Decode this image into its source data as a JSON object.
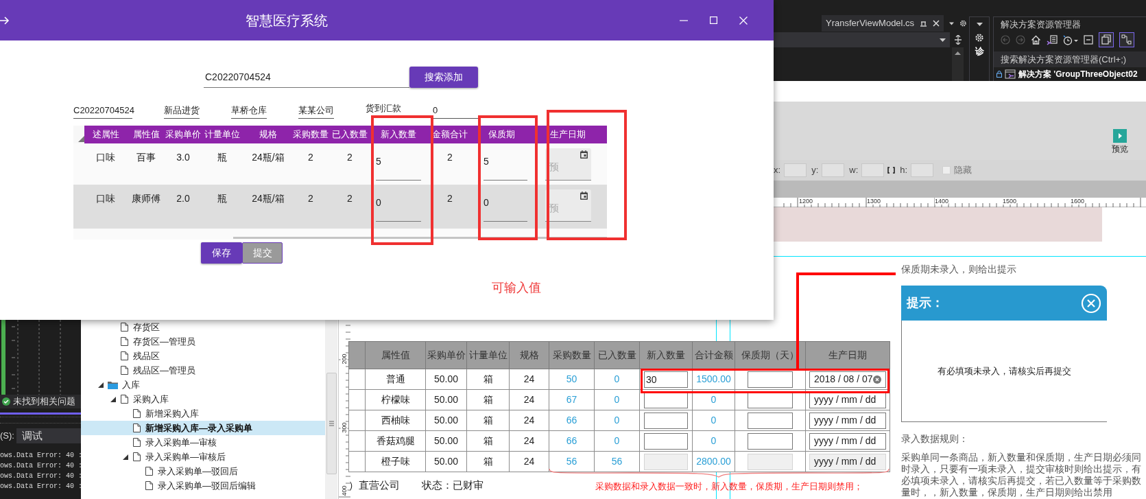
{
  "app_window": {
    "title": "智慧医疗系统",
    "search": {
      "value": "C20220704524"
    },
    "search_button": "搜索添加",
    "order_fields": [
      {
        "kind": "field",
        "value": "C20220704524"
      },
      {
        "kind": "field",
        "value": "新品进货"
      },
      {
        "kind": "field",
        "value": "草桥仓库"
      },
      {
        "kind": "field",
        "value": "某某公司"
      },
      {
        "kind": "label",
        "value": "货到汇款"
      },
      {
        "kind": "field",
        "value": "0"
      }
    ],
    "grid": {
      "columns": [
        "述属性",
        "属性值",
        "采购单价",
        "计量单位",
        "规格",
        "采购数量",
        "已入数量",
        "新入数量",
        "金额合计",
        "保质期",
        "生产日期"
      ],
      "rows": [
        {
          "cells": [
            "口味",
            "百事",
            "3.0",
            "瓶",
            "24瓶/箱",
            "2",
            "2"
          ],
          "new_quantity": "5",
          "amount": "2",
          "shelf_life": "5",
          "date_placeholder": "预"
        },
        {
          "cells": [
            "口味",
            "康师傅",
            "2.0",
            "瓶",
            "24瓶/箱",
            "2",
            "2"
          ],
          "new_quantity": "0",
          "amount": "2",
          "shelf_life": "0",
          "date_placeholder": "预"
        }
      ]
    },
    "buttons": [
      {
        "label": "保存",
        "disabled": false
      },
      {
        "label": "提交",
        "disabled": true
      }
    ],
    "annotation": "可输入值"
  },
  "ide": {
    "editor_tab": "YransferViewModel.cs",
    "diagnostics_label": "诊",
    "explorer_title": "解决方案资源管理器",
    "explorer_search": "搜索解决方案资源管理器(Ctrl+;)",
    "solution": "解决方案 'GroupThreeObject02",
    "preview": "预览",
    "position_labels": [
      "x:",
      "y:",
      "w:",
      "h:"
    ],
    "hide_label": "隐藏",
    "hide_checked": false,
    "ruler_labels": [
      "1200",
      "1300",
      "1400",
      "1500",
      "1600"
    ]
  },
  "error_list": {
    "status": "未找到相关问题",
    "output_label": "(S):",
    "output_source": "调试",
    "output_lines": [
      "ows.Data Error: 40 :",
      "ows.Data Error: 40 :",
      "ows.Data Error: 40 :",
      "ows.Data Error: 40 :"
    ]
  },
  "tree": {
    "upper_children": [
      {
        "label": "存货区",
        "selected": false
      },
      {
        "label": "存货区—管理员",
        "selected": false
      },
      {
        "label": "残品区",
        "selected": false
      },
      {
        "label": "残品区—管理员",
        "selected": false
      }
    ],
    "items": [
      {
        "label": "入库",
        "kind": "folder",
        "expanded": true,
        "selected": false,
        "children": [
          {
            "label": "采购入库",
            "expanded": true,
            "selected": false,
            "children": [
              {
                "label": "新增采购入库",
                "selected": false
              },
              {
                "label": "新增采购入库—录入采购单",
                "selected": true
              },
              {
                "label": "录入采购单—审核",
                "selected": false
              },
              {
                "label": "录入采购单—审核后",
                "expanded": true,
                "selected": false,
                "children": [
                  {
                    "label": "录入采购单—驳回后",
                    "selected": false
                  },
                  {
                    "label": "录入采购单—驳回后编辑",
                    "selected": false
                  }
                ]
              }
            ]
          }
        ]
      }
    ]
  },
  "vertical_ruler": [
    "200",
    "300",
    "400"
  ],
  "design_table": {
    "columns": [
      "属性值",
      "采购单价",
      "计量单位",
      "规格",
      "采购数量",
      "已入数量",
      "新入数量",
      "合计金额",
      "保质期（天）",
      "生产日期"
    ],
    "rows": [
      {
        "value": "普通",
        "price": "50.00",
        "unit": "箱",
        "spec": "24",
        "ordered": "50",
        "received": "0",
        "new_quantity": "30",
        "total": "1500.00",
        "date": "2018 / 08 / 07",
        "disabled": false
      },
      {
        "value": "柠檬味",
        "price": "50.00",
        "unit": "箱",
        "spec": "24",
        "ordered": "67",
        "received": "0",
        "total": "0",
        "date_placeholder": "yyyy / mm / dd",
        "disabled": false
      },
      {
        "value": "西柚味",
        "price": "50.00",
        "unit": "箱",
        "spec": "24",
        "ordered": "66",
        "received": "0",
        "total": "0",
        "date_placeholder": "yyyy / mm / dd",
        "disabled": false
      },
      {
        "value": "香菇鸡腿",
        "price": "50.00",
        "unit": "箱",
        "spec": "24",
        "ordered": "66",
        "received": "0",
        "total": "0",
        "date_placeholder": "yyyy / mm / dd",
        "disabled": false
      },
      {
        "value": "橙子味",
        "price": "50.00",
        "unit": "箱",
        "spec": "24",
        "ordered": "56",
        "received": "56",
        "total": "2800.00",
        "date_placeholder": "yyyy / mm / dd",
        "disabled": true
      }
    ],
    "supplier": "）直营公司",
    "status": "状态：已财审",
    "disabled_note": "采购数据和录入数据一致时，新入数量，保质期，生产日期则禁用；"
  },
  "notes": {
    "prompt_note": "保质期未录入，则给出提示",
    "dialog": {
      "title": "提示：",
      "message": "有必填项未录入，请核实后再提交"
    },
    "rules_title": "录入数据规则：",
    "rules": "采购单同一条商品，新入数量和保质期，生产日期必须同时录入，只要有一项未录入，提交审核时则给出提示，有必填项未录入，请核实后再提交，若已入数量等于采购数量时，，新入数量，保质期，生产日期则给出禁用"
  }
}
